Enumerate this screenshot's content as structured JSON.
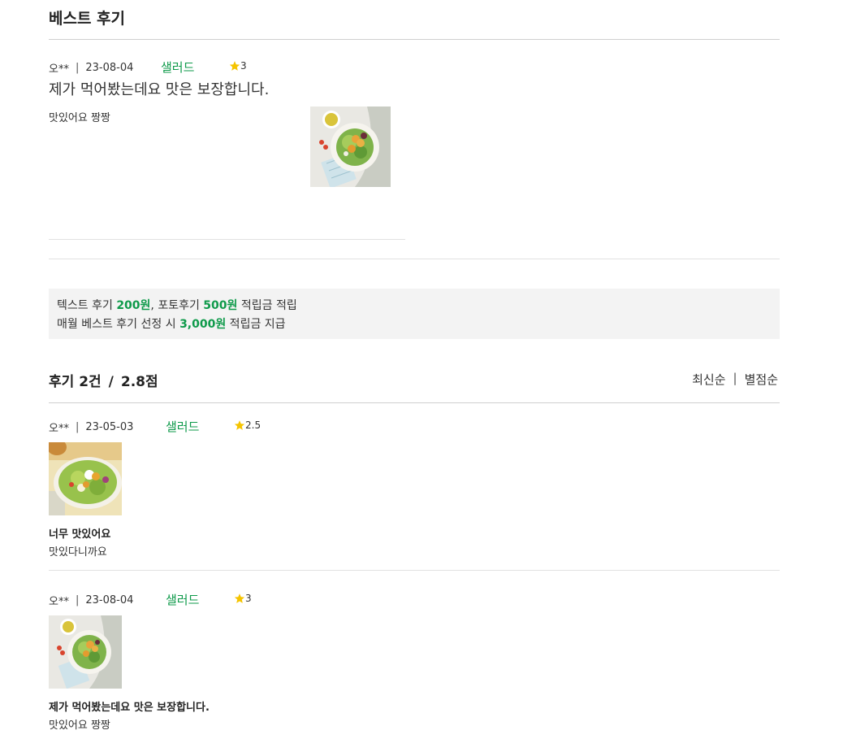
{
  "best": {
    "heading": "베스트 후기",
    "review": {
      "author": "오**",
      "date": "23-08-04",
      "category": "샐러드",
      "rating": "3",
      "title": "제가 먹어봤는데요 맛은 보장합니다.",
      "body": "맛있어요 짱짱",
      "image": "salad-photo-bowl-with-oil"
    }
  },
  "notice": {
    "line1_pre": "텍스트 후기 ",
    "line1_amt1": "200원",
    "line1_mid": ", 포토후기 ",
    "line1_amt2": "500원",
    "line1_post": " 적립금 적립",
    "line2_pre": "매월 베스트 후기 선정 시 ",
    "line2_amt": "3,000원",
    "line2_post": " 적립금 지급"
  },
  "list": {
    "count_label": "후기 2건",
    "slash": "/",
    "score_label": "2.8점",
    "sort_options": [
      "최신순",
      "별점순"
    ],
    "sort_separator": "|",
    "reviews": [
      {
        "author": "오**",
        "date": "23-05-03",
        "category": "샐러드",
        "rating": "2.5",
        "title": "너무 맛있어요",
        "body": "맛있다니까요",
        "image": "salad-photo-greens-egg"
      },
      {
        "author": "오**",
        "date": "23-08-04",
        "category": "샐러드",
        "rating": "3",
        "title": "제가 먹어봤는데요 맛은 보장합니다.",
        "body": "맛있어요 짱짱",
        "image": "salad-photo-bowl-with-oil"
      }
    ]
  },
  "meta_separator": "|",
  "colors": {
    "accent": "#0e9a4a",
    "star": "#f5c400",
    "divider": "#cfcfcf",
    "notice_bg": "#f3f3f3"
  }
}
